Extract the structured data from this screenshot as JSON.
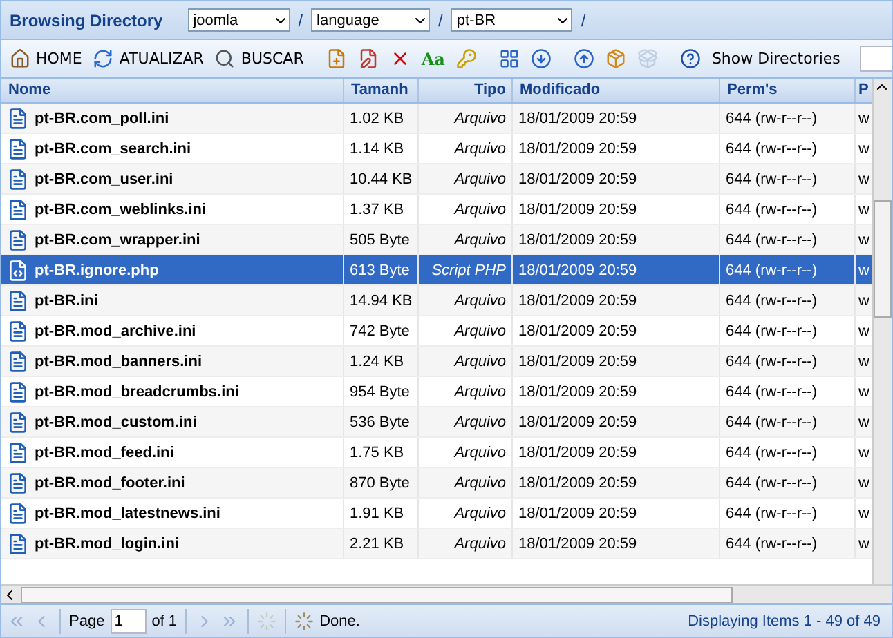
{
  "header": {
    "title": "Browsing Directory",
    "path": [
      {
        "value": "joomla"
      },
      {
        "value": "language"
      },
      {
        "value": "pt-BR"
      }
    ],
    "separator": "/"
  },
  "toolbar": {
    "nav": [
      {
        "kind": "home",
        "label": "HOME"
      },
      {
        "kind": "refresh",
        "label": "ATUALIZAR"
      },
      {
        "kind": "search",
        "label": "BUSCAR"
      }
    ],
    "actions": [
      {
        "kind": "new",
        "disabled": false
      },
      {
        "kind": "edit",
        "disabled": false
      },
      {
        "kind": "delete",
        "disabled": false
      },
      {
        "kind": "rename",
        "text": "Aa",
        "disabled": false
      },
      {
        "kind": "chmod",
        "disabled": false
      },
      {
        "kind": "sep"
      },
      {
        "kind": "view",
        "disabled": false
      },
      {
        "kind": "download",
        "disabled": false
      },
      {
        "kind": "sep"
      },
      {
        "kind": "upload",
        "disabled": false
      },
      {
        "kind": "archive",
        "disabled": false
      },
      {
        "kind": "extract",
        "disabled": true
      },
      {
        "kind": "sep"
      },
      {
        "kind": "help",
        "disabled": false
      }
    ],
    "show_directories": "Show Directories"
  },
  "table": {
    "columns": [
      "Nome",
      "Tamanh",
      "Tipo",
      "Modificado",
      "Perm's",
      "P"
    ],
    "rows": [
      {
        "name": "pt-BR.com_poll.ini",
        "size": "1.02 KB",
        "type": "Arquivo",
        "kind": "ini",
        "modified": "18/01/2009 20:59",
        "perms": "644 (rw-r--r--)",
        "column_6": "w",
        "selected": false
      },
      {
        "name": "pt-BR.com_search.ini",
        "size": "1.14 KB",
        "type": "Arquivo",
        "kind": "ini",
        "modified": "18/01/2009 20:59",
        "perms": "644 (rw-r--r--)",
        "column_6": "w",
        "selected": false
      },
      {
        "name": "pt-BR.com_user.ini",
        "size": "10.44 KB",
        "type": "Arquivo",
        "kind": "ini",
        "modified": "18/01/2009 20:59",
        "perms": "644 (rw-r--r--)",
        "column_6": "w",
        "selected": false
      },
      {
        "name": "pt-BR.com_weblinks.ini",
        "size": "1.37 KB",
        "type": "Arquivo",
        "kind": "ini",
        "modified": "18/01/2009 20:59",
        "perms": "644 (rw-r--r--)",
        "column_6": "w",
        "selected": false
      },
      {
        "name": "pt-BR.com_wrapper.ini",
        "size": "505 Byte",
        "type": "Arquivo",
        "kind": "ini",
        "modified": "18/01/2009 20:59",
        "perms": "644 (rw-r--r--)",
        "column_6": "w",
        "selected": false
      },
      {
        "name": "pt-BR.ignore.php",
        "size": "613 Byte",
        "type": "Script PHP",
        "kind": "php",
        "modified": "18/01/2009 20:59",
        "perms": "644 (rw-r--r--)",
        "column_6": "w",
        "selected": true
      },
      {
        "name": "pt-BR.ini",
        "size": "14.94 KB",
        "type": "Arquivo",
        "kind": "ini",
        "modified": "18/01/2009 20:59",
        "perms": "644 (rw-r--r--)",
        "column_6": "w",
        "selected": false
      },
      {
        "name": "pt-BR.mod_archive.ini",
        "size": "742 Byte",
        "type": "Arquivo",
        "kind": "ini",
        "modified": "18/01/2009 20:59",
        "perms": "644 (rw-r--r--)",
        "column_6": "w",
        "selected": false
      },
      {
        "name": "pt-BR.mod_banners.ini",
        "size": "1.24 KB",
        "type": "Arquivo",
        "kind": "ini",
        "modified": "18/01/2009 20:59",
        "perms": "644 (rw-r--r--)",
        "column_6": "w",
        "selected": false
      },
      {
        "name": "pt-BR.mod_breadcrumbs.ini",
        "size": "954 Byte",
        "type": "Arquivo",
        "kind": "ini",
        "modified": "18/01/2009 20:59",
        "perms": "644 (rw-r--r--)",
        "column_6": "w",
        "selected": false
      },
      {
        "name": "pt-BR.mod_custom.ini",
        "size": "536 Byte",
        "type": "Arquivo",
        "kind": "ini",
        "modified": "18/01/2009 20:59",
        "perms": "644 (rw-r--r--)",
        "column_6": "w",
        "selected": false
      },
      {
        "name": "pt-BR.mod_feed.ini",
        "size": "1.75 KB",
        "type": "Arquivo",
        "kind": "ini",
        "modified": "18/01/2009 20:59",
        "perms": "644 (rw-r--r--)",
        "column_6": "w",
        "selected": false
      },
      {
        "name": "pt-BR.mod_footer.ini",
        "size": "870 Byte",
        "type": "Arquivo",
        "kind": "ini",
        "modified": "18/01/2009 20:59",
        "perms": "644 (rw-r--r--)",
        "column_6": "w",
        "selected": false
      },
      {
        "name": "pt-BR.mod_latestnews.ini",
        "size": "1.91 KB",
        "type": "Arquivo",
        "kind": "ini",
        "modified": "18/01/2009 20:59",
        "perms": "644 (rw-r--r--)",
        "column_6": "w",
        "selected": false
      },
      {
        "name": "pt-BR.mod_login.ini",
        "size": "2.21 KB",
        "type": "Arquivo",
        "kind": "ini",
        "modified": "18/01/2009 20:59",
        "perms": "644 (rw-r--r--)",
        "column_6": "w",
        "selected": false
      }
    ]
  },
  "pager": {
    "page_label": "Page",
    "page": "1",
    "of": "of 1",
    "first_disabled": true,
    "prev_disabled": true,
    "next_disabled": true,
    "last_disabled": true,
    "status": "Done.",
    "summary": "Displaying Items 1 - 49 of 49"
  }
}
